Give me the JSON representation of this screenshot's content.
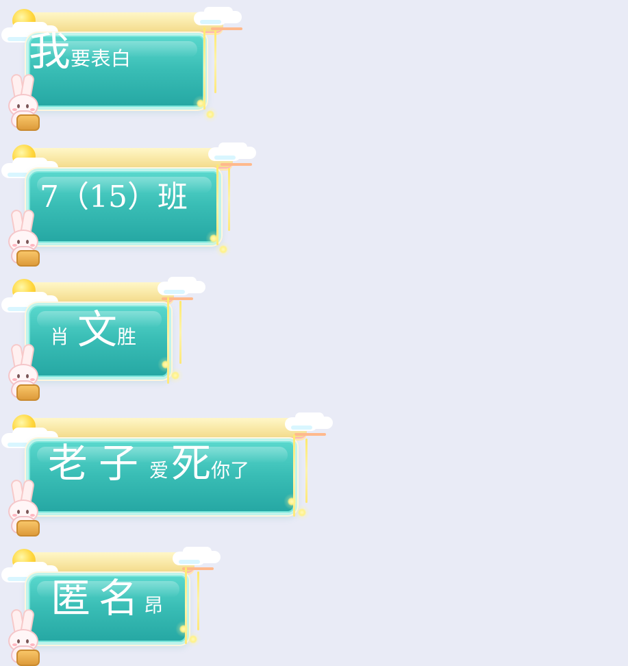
{
  "messages": [
    {
      "segments": [
        {
          "text": "我",
          "size": "large"
        },
        {
          "text": "要",
          "size": "small"
        },
        {
          "text": "表",
          "size": "small"
        },
        {
          "text": "白",
          "size": "small"
        }
      ]
    },
    {
      "segments": [
        {
          "text": "7（15）班",
          "size": "large"
        }
      ]
    },
    {
      "segments": [
        {
          "text": "肖",
          "size": "large"
        },
        {
          "text": "文",
          "size": "large"
        },
        {
          "text": "胜",
          "size": "small"
        }
      ]
    },
    {
      "segments": [
        {
          "text": "老",
          "size": "large"
        },
        {
          "text": "子",
          "size": "large"
        },
        {
          "text": "爱",
          "size": "small"
        },
        {
          "text": "死",
          "size": "large"
        },
        {
          "text": "你",
          "size": "small"
        },
        {
          "text": "了",
          "size": "small"
        }
      ]
    },
    {
      "segments": [
        {
          "text": "匿",
          "size": "large"
        },
        {
          "text": "名",
          "size": "large"
        },
        {
          "text": "昂",
          "size": "small"
        }
      ]
    }
  ],
  "icons": {
    "sun": "sun-icon",
    "cloud": "cloud-icon",
    "rabbit": "rabbit-icon",
    "mooncake": "mooncake-icon",
    "tassel": "tassel-icon"
  },
  "colors": {
    "background": "#e9ebf6",
    "bubble": "#39bdb5",
    "text": "#ffffff"
  }
}
